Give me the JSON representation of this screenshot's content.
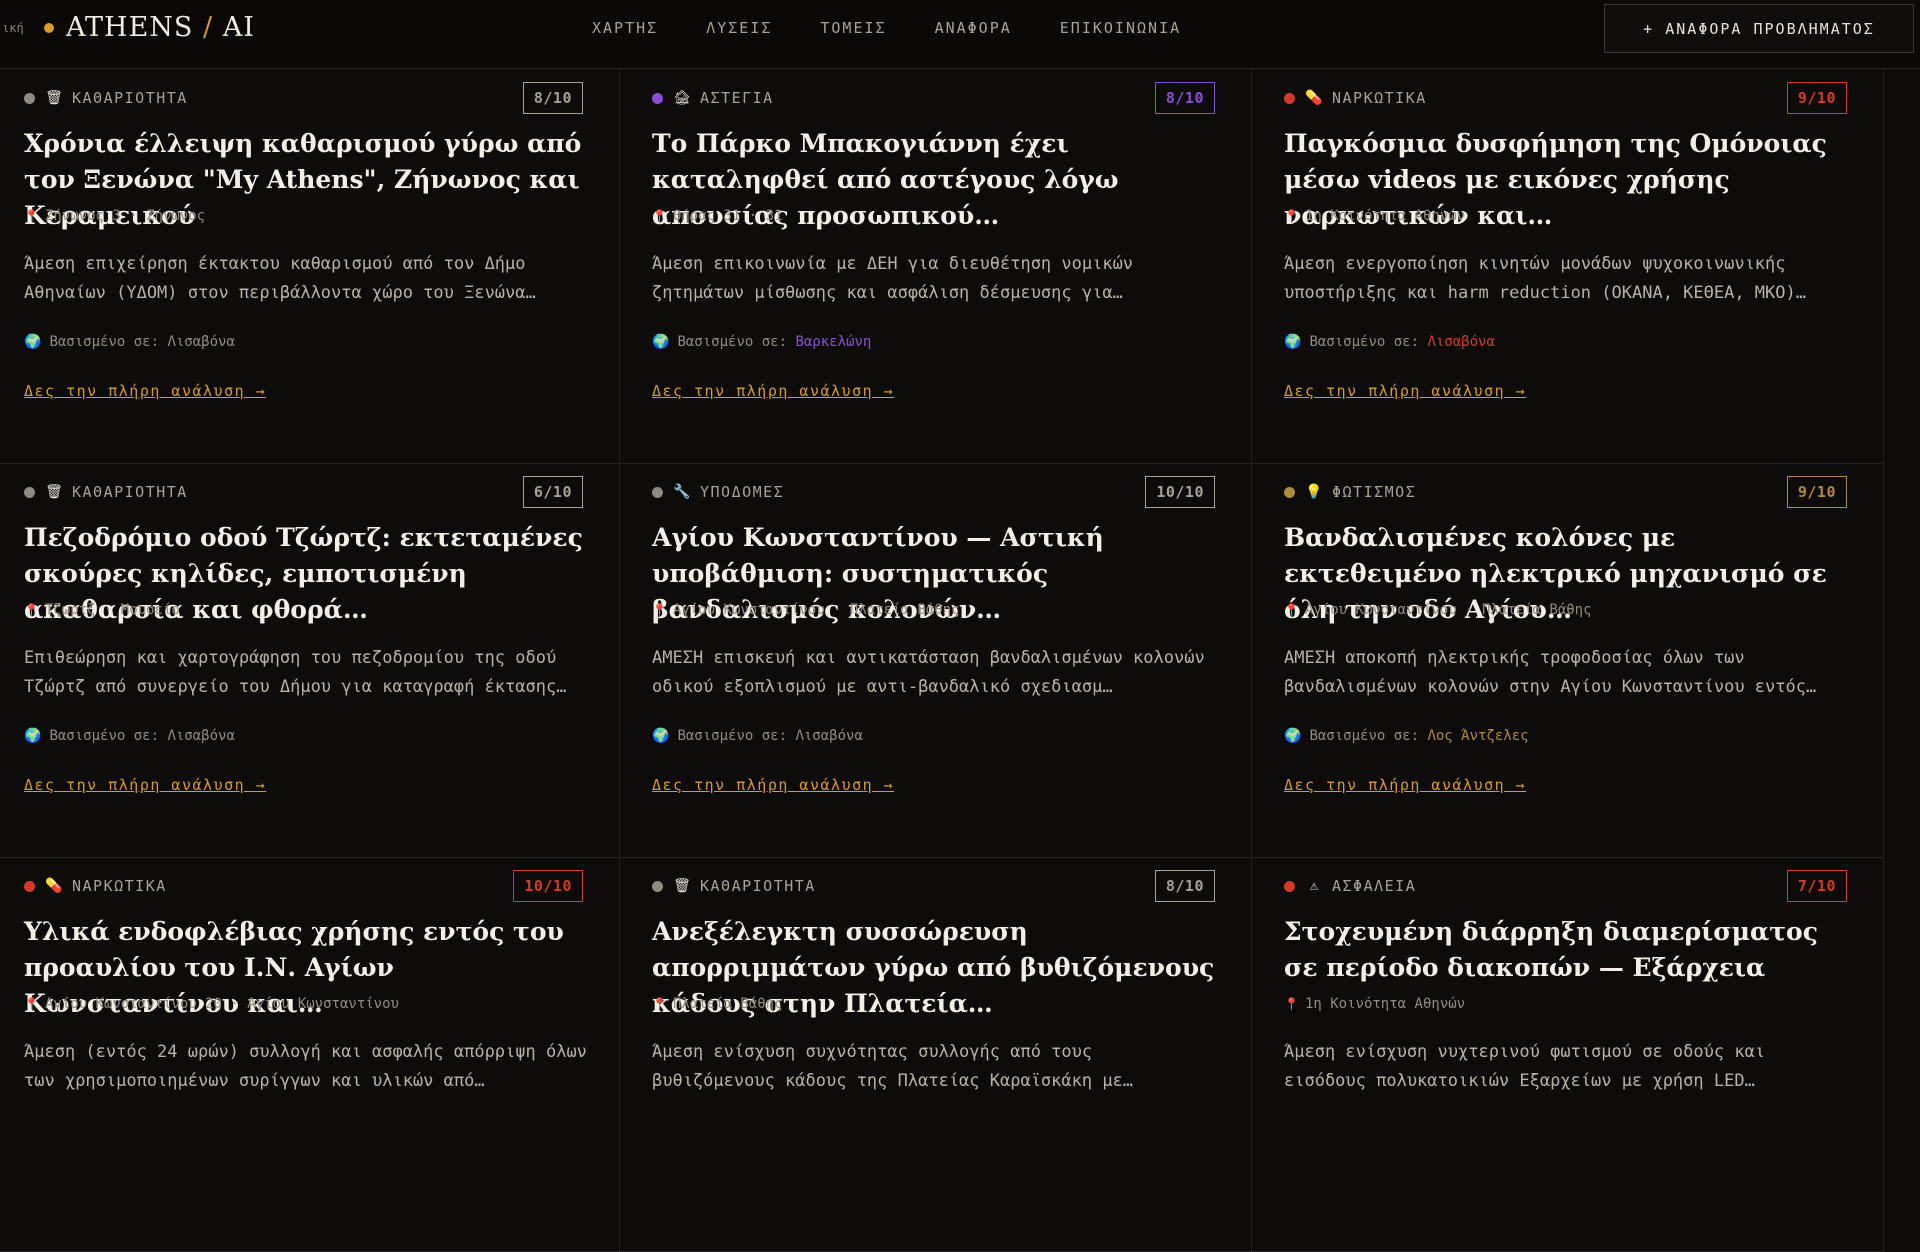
{
  "header": {
    "logo_prefix": "ική",
    "logo_left": "ATHENS",
    "logo_sep": "/",
    "logo_right": "AI",
    "nav": [
      "ΧΑΡΤΗΣ",
      "ΛΥΣΕΙΣ",
      "ΤΟΜΕΙΣ",
      "ΑΝΑΦΟΡΑ",
      "ΕΠΙΚΟΙΝΩΝΙΑ"
    ],
    "report_button": "+ ΑΝΑΦΟΡΑ ΠΡΟΒΛΗΜΑΤΟΣ"
  },
  "labels": {
    "based_on": "Βασισμένο σε:",
    "read_more": "Δες την πλήρη ανάλυση →"
  },
  "colors": {
    "accent": "#d99b2b",
    "gray": "#8f8a82",
    "purple": "#8a4fd6",
    "red": "#d33a2c",
    "gold": "#b08a3e"
  },
  "cards": [
    {
      "category": "ΚΑΘΑΡΙΟΤΗΤΑ",
      "icon": "trash-icon",
      "glyph": "🗑",
      "dot": "#8f8a82",
      "score_color": "#a8a196",
      "score": "8/10",
      "title": "Χρόνια έλλειψη καθαρισμού γύρω από τον Ξενώνα \"My Athens\", Ζήνωνος και Κεραμεικού",
      "location": "Ζήνωνος 3 · Ζήνωνος",
      "description": "Άμεση επιχείρηση έκτακτου καθαρισμού από τον Δήμο Αθηναίων (ΥΔΟΜ) στον περιβάλλοντα χώρο του Ξενώνα…",
      "based_on": "Λισαβόνα",
      "based_color": "#928b80"
    },
    {
      "category": "ΑΣΤΕΓΙΑ",
      "icon": "house-icon",
      "glyph": "🏚",
      "dot": "#8a4fd6",
      "score_color": "#8a4fd6",
      "score": "8/10",
      "title": "Το Πάρκο Μπακογιάννη έχει καταληφθεί από αστέγους λόγω απουσίας προσωπικού…",
      "location": "Θήρας 31 · 31",
      "description": "Άμεση επικοινωνία με ΔΕΗ για διευθέτηση νομικών ζητημάτων μίσθωσης και ασφάλιση δέσμευσης για…",
      "based_on": "Βαρκελώνη",
      "based_color": "#8a4fd6"
    },
    {
      "category": "ΝΑΡΚΩΤΙΚΑ",
      "icon": "pill-icon",
      "glyph": "💊",
      "dot": "#d33a2c",
      "score_color": "#d33a2c",
      "score": "9/10",
      "title": "Παγκόσμια δυσφήμηση της Ομόνοιας μέσω videos με εικόνες χρήσης ναρκωτικών και…",
      "location": "1η Κοινότητα Αθηνών",
      "description": "Άμεση ενεργοποίηση κινητών μονάδων ψυχοκοινωνικής υποστήριξης και harm reduction (ΟΚΑΝΑ, ΚΕΘΕΑ, ΜΚΟ)…",
      "based_on": "Λισαβόνα",
      "based_color": "#d33a2c"
    },
    {
      "category": "ΚΑΘΑΡΙΟΤΗΤΑ",
      "icon": "trash-icon",
      "glyph": "🗑",
      "dot": "#8f8a82",
      "score_color": "#a8a196",
      "score": "6/10",
      "title": "Πεζοδρόμιο οδού Τζώρτζ: εκτεταμένες σκούρες κηλίδες, εμποτισμένη ακαθαρσία και φθορά…",
      "location": "Τζωρτζ · Μουσείο",
      "description": "Επιθεώρηση και χαρτογράφηση του πεζοδρομίου της οδού Τζώρτζ από συνεργείο του Δήμου για καταγραφή έκτασης…",
      "based_on": "Λισαβόνα",
      "based_color": "#928b80"
    },
    {
      "category": "ΥΠΟΔΟΜΕΣ",
      "icon": "wrench-icon",
      "glyph": "🔧",
      "dot": "#8f8a82",
      "score_color": "#a8a196",
      "score": "10/10",
      "title": "Αγίου Κωνσταντίνου — Αστική υποβάθμιση: συστηματικός βανδαλισμός κολονών…",
      "location": "Αγίου Κωνσταντίνου · Πλατεία Βάθης",
      "description": "ΑΜΕΣΗ επισκευή και αντικατάσταση βανδαλισμένων κολονών οδικού εξοπλισμού με αντι-βανδαλικό σχεδιασμ…",
      "based_on": "Λισαβόνα",
      "based_color": "#928b80"
    },
    {
      "category": "ΦΩΤΙΣΜΟΣ",
      "icon": "lightbulb-icon",
      "glyph": "💡",
      "dot": "#b08a3e",
      "score_color": "#b08a3e",
      "score": "9/10",
      "title": "Βανδαλισμένες κολόνες με εκτεθειμένο ηλεκτρικό μηχανισμό σε όλη την οδό Αγίου…",
      "location": "Αγίου Κωνσταντίνου · Πλατεία Βάθης",
      "description": "ΑΜΕΣΗ αποκοπή ηλεκτρικής τροφοδοσίας όλων των βανδαλισμένων κολονών στην Αγίου Κωνσταντίνου εντός…",
      "based_on": "Λος Άντζελες",
      "based_color": "#b08a3e"
    },
    {
      "category": "ΝΑΡΚΩΤΙΚΑ",
      "icon": "pill-icon",
      "glyph": "💊",
      "dot": "#d33a2c",
      "score_color": "#d33a2c",
      "score": "10/10",
      "title": "Υλικά ενδοφλέβιας χρήσης εντός του προαυλίου του Ι.Ν. Αγίων Κωνσταντίνου και…",
      "location": "Αγίου Κωνσταντίνου 20 · Αγίου Κωνσταντίνου",
      "description": "Άμεση (εντός 24 ωρών) συλλογή και ασφαλής απόρριψη όλων των χρησιμοποιημένων συρίγγων και υλικών από…",
      "based_on": "",
      "based_color": "#928b80"
    },
    {
      "category": "ΚΑΘΑΡΙΟΤΗΤΑ",
      "icon": "trash-icon",
      "glyph": "🗑",
      "dot": "#8f8a82",
      "score_color": "#a8a196",
      "score": "8/10",
      "title": "Ανεξέλεγκτη συσσώρευση απορριμμάτων γύρω από βυθιζόμενους κάδους στην Πλατεία…",
      "location": "Πλατεία Βάθης",
      "description": "Άμεση ενίσχυση συχνότητας συλλογής από τους βυθιζόμενους κάδους της Πλατείας Καραϊσκάκη με…",
      "based_on": "",
      "based_color": "#928b80"
    },
    {
      "category": "ΑΣΦΑΛΕΙΑ",
      "icon": "warning-icon",
      "glyph": "⚠",
      "dot": "#d33a2c",
      "score_color": "#d33a2c",
      "score": "7/10",
      "title": "Στοχευμένη διάρρηξη διαμερίσματος σε περίοδο διακοπών — Εξάρχεια",
      "location": "1η Κοινότητα Αθηνών",
      "description": "Άμεση ενίσχυση νυχτερινού φωτισμού σε οδούς και εισόδους πολυκατοικιών Εξαρχείων με χρήση LED…",
      "based_on": "",
      "based_color": "#928b80"
    }
  ]
}
